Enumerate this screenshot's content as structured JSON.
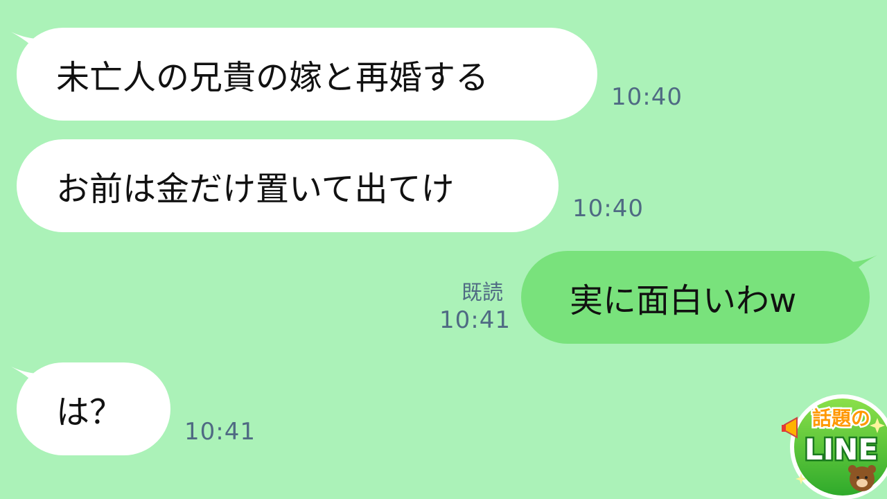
{
  "colors": {
    "background": "#abf2b8",
    "incoming_bubble": "#ffffff",
    "outgoing_bubble": "#79e27c",
    "timestamp": "#4f6a83"
  },
  "messages": [
    {
      "direction": "incoming",
      "text": "未亡人の兄貴の嫁と再婚する",
      "time": "10:40"
    },
    {
      "direction": "incoming",
      "text": "お前は金だけ置いて出てけ",
      "time": "10:40"
    },
    {
      "direction": "outgoing",
      "text": "実に面白いわw",
      "time": "10:41",
      "read_label": "既読"
    },
    {
      "direction": "incoming",
      "text": "は？",
      "time": "10:41"
    }
  ],
  "logo": {
    "title_text": "話題の",
    "brand_text": "LINE",
    "icons": [
      "megaphone-icon",
      "bear-icon",
      "sparkle-icon"
    ]
  }
}
